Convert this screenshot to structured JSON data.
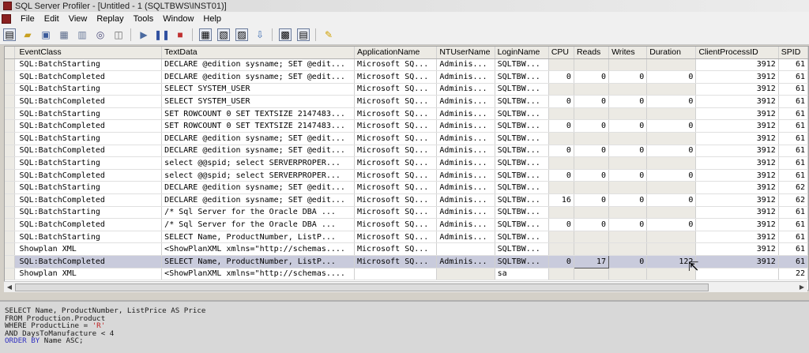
{
  "window": {
    "title": "SQL Server Profiler - [Untitled - 1 (SQLTBWS\\INST01)]"
  },
  "menu": [
    "File",
    "Edit",
    "View",
    "Replay",
    "Tools",
    "Window",
    "Help"
  ],
  "toolbar": {
    "buttons": [
      "new-trace-icon",
      "open-icon",
      "save-icon",
      "properties-icon",
      "open-table-icon",
      "find-icon",
      "clear-icon",
      "run-icon",
      "pause-icon",
      "stop-icon",
      "template-icon",
      "template-properties-icon",
      "table-icon",
      "import-icon",
      "performance-icon",
      "chart-icon",
      "help-icon"
    ]
  },
  "grid": {
    "columns": [
      "EventClass",
      "TextData",
      "ApplicationName",
      "NTUserName",
      "LoginName",
      "CPU",
      "Reads",
      "Writes",
      "Duration",
      "ClientProcessID",
      "SPID"
    ],
    "rows": [
      [
        "SQL:BatchStarting",
        "DECLARE @edition sysname; SET @edit...",
        "Microsoft SQ...",
        "Adminis...",
        "SQLTBW...",
        "",
        "",
        "",
        "",
        "3912",
        "61"
      ],
      [
        "SQL:BatchCompleted",
        "DECLARE @edition sysname; SET @edit...",
        "Microsoft SQ...",
        "Adminis...",
        "SQLTBW...",
        "0",
        "0",
        "0",
        "0",
        "3912",
        "61"
      ],
      [
        "SQL:BatchStarting",
        "SELECT SYSTEM_USER",
        "Microsoft SQ...",
        "Adminis...",
        "SQLTBW...",
        "",
        "",
        "",
        "",
        "3912",
        "61"
      ],
      [
        "SQL:BatchCompleted",
        "SELECT SYSTEM_USER",
        "Microsoft SQ...",
        "Adminis...",
        "SQLTBW...",
        "0",
        "0",
        "0",
        "0",
        "3912",
        "61"
      ],
      [
        "SQL:BatchStarting",
        "SET ROWCOUNT 0 SET TEXTSIZE 2147483...",
        "Microsoft SQ...",
        "Adminis...",
        "SQLTBW...",
        "",
        "",
        "",
        "",
        "3912",
        "61"
      ],
      [
        "SQL:BatchCompleted",
        "SET ROWCOUNT 0 SET TEXTSIZE 2147483...",
        "Microsoft SQ...",
        "Adminis...",
        "SQLTBW...",
        "0",
        "0",
        "0",
        "0",
        "3912",
        "61"
      ],
      [
        "SQL:BatchStarting",
        "DECLARE @edition sysname; SET @edit...",
        "Microsoft SQ...",
        "Adminis...",
        "SQLTBW...",
        "",
        "",
        "",
        "",
        "3912",
        "61"
      ],
      [
        "SQL:BatchCompleted",
        "DECLARE @edition sysname; SET @edit...",
        "Microsoft SQ...",
        "Adminis...",
        "SQLTBW...",
        "0",
        "0",
        "0",
        "0",
        "3912",
        "61"
      ],
      [
        "SQL:BatchStarting",
        "select @@spid;  select SERVERPROPER...",
        "Microsoft SQ...",
        "Adminis...",
        "SQLTBW...",
        "",
        "",
        "",
        "",
        "3912",
        "61"
      ],
      [
        "SQL:BatchCompleted",
        "select @@spid;  select SERVERPROPER...",
        "Microsoft SQ...",
        "Adminis...",
        "SQLTBW...",
        "0",
        "0",
        "0",
        "0",
        "3912",
        "61"
      ],
      [
        "SQL:BatchStarting",
        "DECLARE @edition sysname; SET @edit...",
        "Microsoft SQ...",
        "Adminis...",
        "SQLTBW...",
        "",
        "",
        "",
        "",
        "3912",
        "62"
      ],
      [
        "SQL:BatchCompleted",
        "DECLARE @edition sysname; SET @edit...",
        "Microsoft SQ...",
        "Adminis...",
        "SQLTBW...",
        "16",
        "0",
        "0",
        "0",
        "3912",
        "62"
      ],
      [
        "SQL:BatchStarting",
        "/* Sql Server for the Oracle DBA   ...",
        "Microsoft SQ...",
        "Adminis...",
        "SQLTBW...",
        "",
        "",
        "",
        "",
        "3912",
        "61"
      ],
      [
        "SQL:BatchCompleted",
        "/* Sql Server for the Oracle DBA   ...",
        "Microsoft SQ...",
        "Adminis...",
        "SQLTBW...",
        "0",
        "0",
        "0",
        "0",
        "3912",
        "61"
      ],
      [
        "SQL:BatchStarting",
        "   SELECT Name, ProductNumber, ListP...",
        "Microsoft SQ...",
        "Adminis...",
        "SQLTBW...",
        "",
        "",
        "",
        "",
        "3912",
        "61"
      ],
      [
        "Showplan XML",
        "<ShowPlanXML xmlns=\"http://schemas....",
        "Microsoft SQ...",
        "",
        "SQLTBW...",
        "",
        "",
        "",
        "",
        "3912",
        "61"
      ],
      [
        "SQL:BatchCompleted",
        "   SELECT Name, ProductNumber, ListP...",
        "Microsoft SQ...",
        "Adminis...",
        "SQLTBW...",
        "0",
        "17",
        "0",
        "122",
        "3912",
        "61"
      ],
      [
        "Showplan XML",
        "<ShowPlanXML xmlns=\"http://schemas....",
        "",
        "",
        "sa",
        "",
        "",
        "",
        "",
        "",
        "22"
      ]
    ],
    "selected_row_index": 16
  },
  "detail": {
    "lines": [
      [
        {
          "t": "SELECT Name, ProductNumber, ListPrice AS Price",
          "c": ""
        }
      ],
      [
        {
          "t": "FROM Production.Product",
          "c": ""
        }
      ],
      [
        {
          "t": "WHERE ProductLine = ",
          "c": ""
        },
        {
          "t": "'R'",
          "c": "str"
        }
      ],
      [
        {
          "t": "AND DaysToManufacture < 4",
          "c": ""
        }
      ],
      [
        {
          "t": "ORDER BY",
          "c": "kw"
        },
        {
          "t": " Name ASC;",
          "c": ""
        }
      ]
    ]
  }
}
